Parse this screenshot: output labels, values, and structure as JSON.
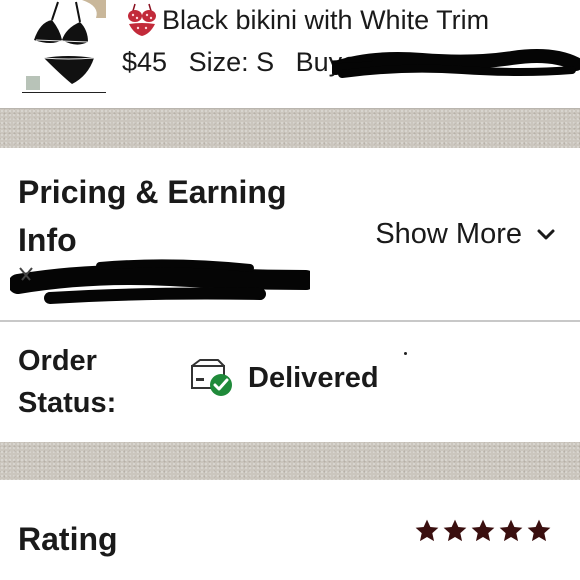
{
  "item": {
    "image_icon": "bikini-product-thumbnail",
    "title_emoji_icon": "bikini-emoji-icon",
    "title": "Black bikini with White Trim",
    "price": "$45",
    "size": "Size: S",
    "buyer_label": "Buyer:"
  },
  "pricing": {
    "title": "Pricing & Earning Info",
    "show_more": "Show More",
    "show_more_icon": "chevron-down-icon"
  },
  "order": {
    "status_label": "Order Status:",
    "status_icon": "package-delivered-icon",
    "status_value": "Delivered",
    "status_color": "#1f8a3a"
  },
  "rating": {
    "label": "Rating",
    "stars": 5,
    "max_stars": 5,
    "star_color": "#3a0f0f"
  },
  "colors": {
    "separator": "#cbc6be",
    "text": "#1a1a1a"
  }
}
